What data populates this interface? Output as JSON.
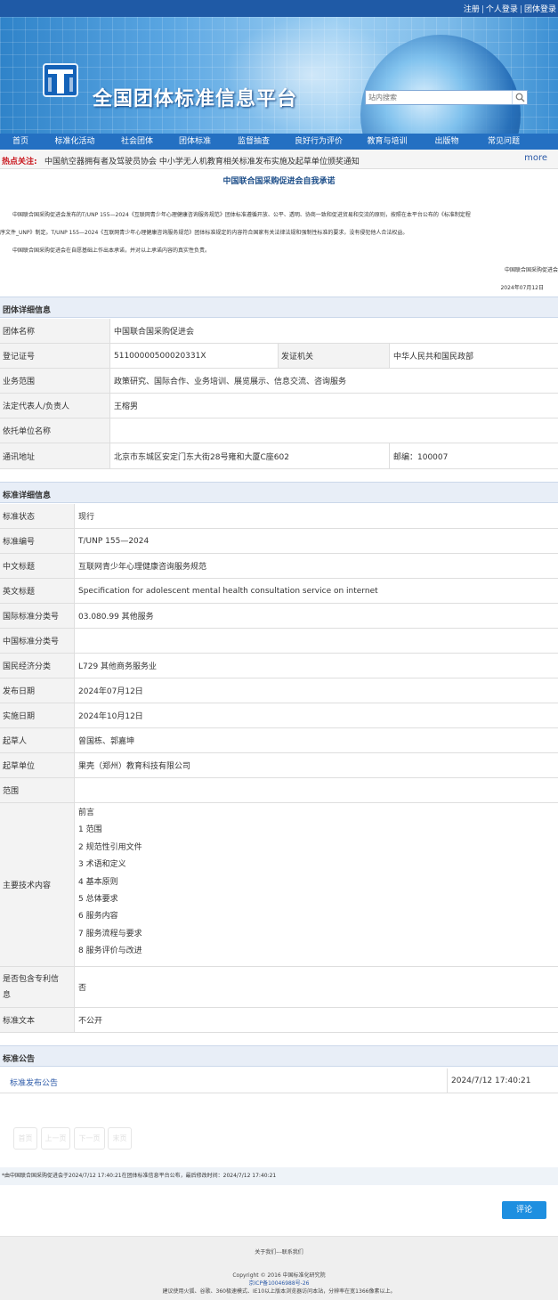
{
  "top_links": {
    "register": "注册",
    "personal_login": "个人登录",
    "group_login": "团体登录",
    "separator": "|"
  },
  "site_title": "全国团体标准信息平台",
  "search": {
    "placeholder": "站内搜索"
  },
  "nav": [
    "首页",
    "标准化活动",
    "社会团体",
    "团体标准",
    "监督抽查",
    "良好行为评价",
    "教育与培训",
    "出版物",
    "常见问题"
  ],
  "hot": {
    "label": "热点关注:",
    "news": "中国航空器拥有者及驾驶员协会 中小学无人机教育相关标准发布实施及起草单位颁奖通知",
    "more": "more"
  },
  "notice": {
    "title": "中国联合国采购促进会自我承诺",
    "p1a": "中国联合国采购促进会发布的T/UNP 155—2024《互联网青少年心理健康咨询服务规范》团体标准遵循开放、公平、透明、协商一致和促进贸易和交流的原则，按照在本平台公布的《标准制定程",
    "p1b": "序文件_UNP》制定。T/UNP 155—2024《互联网青少年心理健康咨询服务规范》团体标准规定的内容符合国家有关法律法规和强制性标准的要求，没有侵犯他人合法权益。",
    "p2": "中国联合国采购促进会在自愿基础上作出本承诺，并对以上承诺内容的真实性负责。",
    "signer": "中国联合国采购促进会",
    "date": "2024年07月12日"
  },
  "group_section": {
    "title": "团体详细信息",
    "name_label": "团体名称",
    "name_value": "中国联合国采购促进会",
    "reg_label": "登记证号",
    "reg_value": "51100000500020331X",
    "issuer_label": "发证机关",
    "issuer_value": "中华人民共和国民政部",
    "scope_label": "业务范围",
    "scope_value": "政策研究、国际合作、业务培训、展览展示、信息交流、咨询服务",
    "rep_label": "法定代表人/负责人",
    "rep_value": "王榕男",
    "sponsor_label": "依托单位名称",
    "sponsor_value": "",
    "addr_label": "通讯地址",
    "addr_value": "北京市东城区安定门东大街28号雍和大厦C座602",
    "post_value": "邮编：100007"
  },
  "standard_section": {
    "title": "标准详细信息",
    "rows": [
      {
        "label": "标准状态",
        "value": "现行"
      },
      {
        "label": "标准编号",
        "value": "T/UNP 155—2024"
      },
      {
        "label": "中文标题",
        "value": "互联网青少年心理健康咨询服务规范"
      },
      {
        "label": "英文标题",
        "value": "Specification for adolescent mental health consultation service on internet"
      },
      {
        "label": "国际标准分类号",
        "value": "03.080.99 其他服务"
      },
      {
        "label": "中国标准分类号",
        "value": ""
      },
      {
        "label": "国民经济分类",
        "value": "L729 其他商务服务业"
      },
      {
        "label": "发布日期",
        "value": "2024年07月12日"
      },
      {
        "label": "实施日期",
        "value": "2024年10月12日"
      },
      {
        "label": "起草人",
        "value": "曾国栋、郭嘉坤"
      },
      {
        "label": "起草单位",
        "value": "果壳（郑州）教育科技有限公司"
      },
      {
        "label": "范围",
        "value": ""
      }
    ],
    "tech_label": "主要技术内容",
    "tech_items": [
      "前言",
      "1  范围",
      "2  规范性引用文件",
      "3  术语和定义",
      "4  基本原则",
      "5  总体要求",
      "6  服务内容",
      "7  服务流程与要求",
      "8  服务评价与改进"
    ],
    "patent_label_1": "是否包含专利信",
    "patent_label_2": "息",
    "patent_value": "否",
    "text_label": "标准文本",
    "text_value": "不公开"
  },
  "announcement": {
    "title": "标准公告",
    "link": "标准发布公告",
    "date": "2024/7/12 17:40:21"
  },
  "pager": [
    "首页",
    "上一页",
    "下一页",
    "末页"
  ],
  "publish_note": "*由中国联合国采购促进会于2024/7/12 17:40:21在团体标准信息平台公布，最后修改时间：2024/7/12 17:40:21",
  "comment_button": "评论",
  "footer": {
    "links": "关于我们---联系我们",
    "copyright": "Copyright © 2016 中国标准化研究院",
    "icp": "京ICP备10046988号-26",
    "browser": "建议使用火狐、谷歌、360极速模式、IE10以上版本浏览器访问本站，分辨率在宽1366像素以上。"
  },
  "colors": {
    "topbar": "#1f5aa6",
    "nav": "#2470c2",
    "hot_label": "#c9171e",
    "link": "#2c5aa8",
    "button": "#1e8fe0"
  }
}
